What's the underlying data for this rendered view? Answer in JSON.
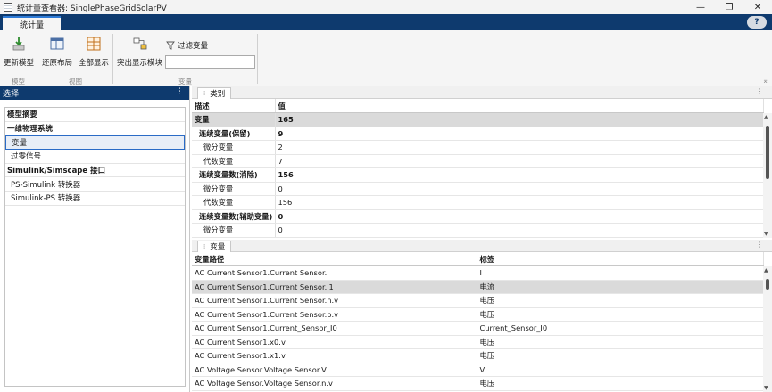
{
  "window": {
    "title": "统计量查看器: SinglePhaseGridSolarPV",
    "minimize": "—",
    "restore": "❐",
    "close": "✕"
  },
  "tabstrip": {
    "active_tab": "统计量",
    "help": "?"
  },
  "toolstrip": {
    "update_model": "更新模型",
    "restore_layout": "还原布局",
    "show_all": "全部显示",
    "highlight_block": "突出显示模块",
    "filter_variables": "过滤变量",
    "filter_value": "",
    "sections": {
      "model": "模型",
      "view": "视图",
      "variables": "变量"
    },
    "collapse": "⌅"
  },
  "left_panel": {
    "title": "选择",
    "menu": "⋮",
    "items": [
      {
        "label": "模型摘要"
      },
      {
        "label": "一维物理系统"
      },
      {
        "label": "变量"
      },
      {
        "label": "过零信号"
      },
      {
        "label": "Simulink/Simscape 接口"
      },
      {
        "label": "PS-Simulink 转换器"
      },
      {
        "label": "Simulink-PS 转换器"
      }
    ]
  },
  "category_panel": {
    "tab": "类别",
    "menu": "⋮",
    "headers": [
      "描述",
      "值"
    ],
    "rows": [
      {
        "desc": "变量",
        "value": "165"
      },
      {
        "desc": "连续变量(保留)",
        "value": "9"
      },
      {
        "desc": "微分变量",
        "value": "2"
      },
      {
        "desc": "代数变量",
        "value": "7"
      },
      {
        "desc": "连续变量数(消除)",
        "value": "156"
      },
      {
        "desc": "微分变量",
        "value": "0"
      },
      {
        "desc": "代数变量",
        "value": "156"
      },
      {
        "desc": "连续变量数(辅助变量)",
        "value": "0"
      },
      {
        "desc": "微分变量",
        "value": "0"
      }
    ]
  },
  "variables_panel": {
    "tab": "变量",
    "menu": "⋮",
    "headers": [
      "变量路径",
      "标签"
    ],
    "rows": [
      {
        "path": "AC Current Sensor1.Current Sensor.I",
        "label": "I"
      },
      {
        "path": "AC Current Sensor1.Current Sensor.i1",
        "label": "电流"
      },
      {
        "path": "AC Current Sensor1.Current Sensor.n.v",
        "label": "电压"
      },
      {
        "path": "AC Current Sensor1.Current Sensor.p.v",
        "label": "电压"
      },
      {
        "path": "AC Current Sensor1.Current_Sensor_I0",
        "label": "Current_Sensor_I0"
      },
      {
        "path": "AC Current Sensor1.x0.v",
        "label": "电压"
      },
      {
        "path": "AC Current Sensor1.x1.v",
        "label": "电压"
      },
      {
        "path": "AC Voltage Sensor.Voltage Sensor.V",
        "label": "V"
      },
      {
        "path": "AC Voltage Sensor.Voltage Sensor.n.v",
        "label": "电压"
      }
    ]
  },
  "colors": {
    "accent": "#0e3a6e",
    "selection_border": "#2a6bc6",
    "highlight_row": "#dadada"
  }
}
